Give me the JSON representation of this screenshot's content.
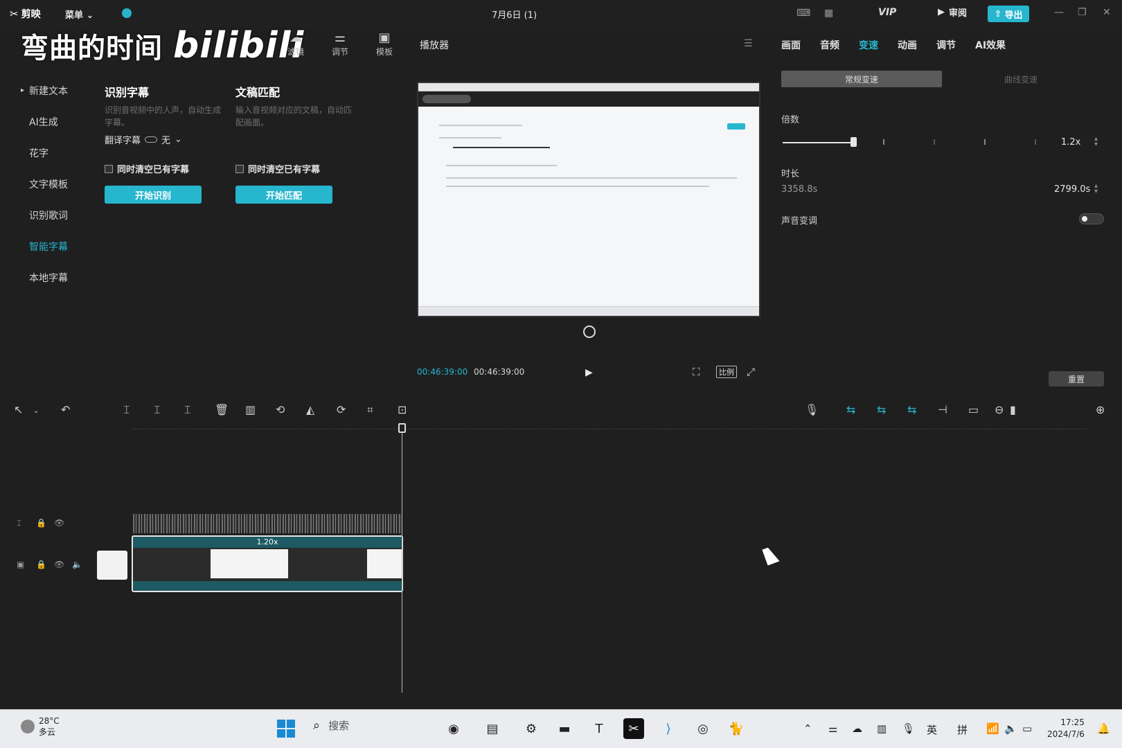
{
  "app": {
    "name": "剪映",
    "menu_label": "菜单",
    "doc_title": "7月6日 (1)",
    "review_label": "审阅",
    "export_label": "导出",
    "vip_label": "VIP"
  },
  "watermark": {
    "text": "弯曲的时间",
    "brand": "bilibili"
  },
  "toolbar_tabs": [
    {
      "label": "滤镜",
      "icon": "filter-icon"
    },
    {
      "label": "调节",
      "icon": "adjust-icon"
    },
    {
      "label": "模板",
      "icon": "template-icon"
    }
  ],
  "leftnav": {
    "items": [
      {
        "label": "新建文本"
      },
      {
        "label": "AI生成"
      },
      {
        "label": "花字"
      },
      {
        "label": "文字模板"
      },
      {
        "label": "识别歌词"
      },
      {
        "label": "智能字幕"
      },
      {
        "label": "本地字幕"
      }
    ],
    "active_index": 5
  },
  "captions": {
    "recognize": {
      "title": "识别字幕",
      "desc": "识别音视频中的人声，自动生成字幕。",
      "translate_label": "翻译字幕",
      "translate_value": "无",
      "clear_label": "同时清空已有字幕",
      "button": "开始识别"
    },
    "match": {
      "title": "文稿匹配",
      "desc": "输入音视频对应的文稿，自动匹配画面。",
      "clear_label": "同时清空已有字幕",
      "button": "开始匹配"
    }
  },
  "player": {
    "title": "播放器",
    "current_time": "00:46:39:00",
    "total_time": "00:46:39:00",
    "ratio_label": "比例"
  },
  "inspector": {
    "tabs": [
      "画面",
      "音频",
      "变速",
      "动画",
      "调节",
      "AI效果"
    ],
    "active_tab": 2,
    "speed_modes": [
      "常规变速",
      "曲线变速"
    ],
    "multiplier_label": "倍数",
    "multiplier_value": "1.2x",
    "multiplier_fraction": 0.28,
    "duration_label": "时长",
    "duration_original": "3358.8s",
    "duration_new": "2799.0s",
    "pitch_label": "声音变调",
    "reset_label": "重置"
  },
  "timeline": {
    "clip_speed": "1.20x"
  },
  "taskbar": {
    "temperature": "28°C",
    "weather": "多云",
    "search_placeholder": "搜索",
    "ime_lang": "英",
    "ime_mode": "拼",
    "time": "17:25",
    "date": "2024/7/6"
  },
  "colors": {
    "accent": "#26b6ce",
    "background": "#1f1f20",
    "taskbar": "#eaecef"
  }
}
